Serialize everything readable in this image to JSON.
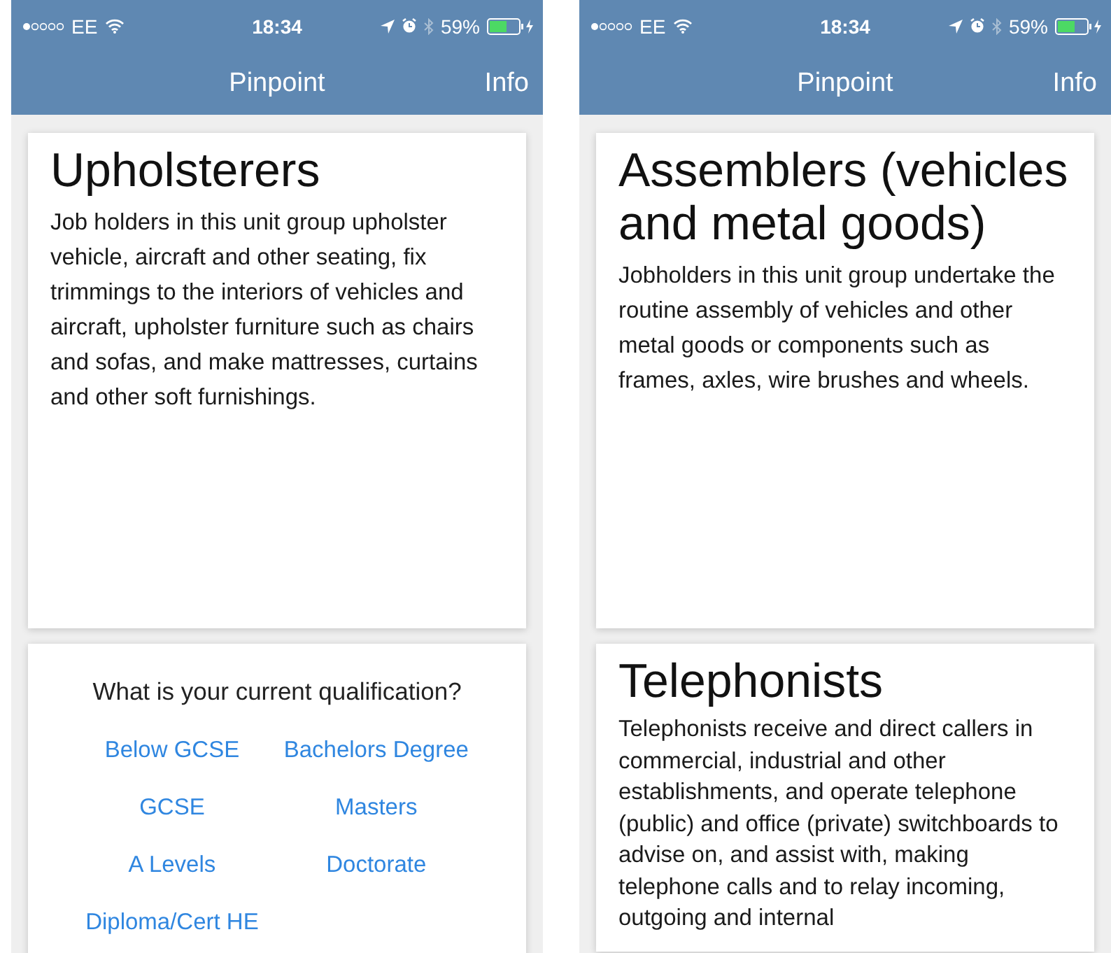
{
  "phones": [
    {
      "status_bar": {
        "carrier": "EE",
        "time": "18:34",
        "battery": "59%"
      },
      "nav": {
        "title": "Pinpoint",
        "action": "Info"
      },
      "cards": [
        {
          "kind": "description",
          "title": "Upholsterers",
          "body": "Job holders in this unit group upholster vehicle, aircraft and other seating, fix trimmings to the interiors of vehicles and aircraft, upholster furniture such as chairs and sofas, and make mattresses, curtains and other soft furnishings."
        },
        {
          "kind": "question",
          "question": "What is your current qualification?",
          "options": [
            "Below GCSE",
            "Bachelors Degree",
            "GCSE",
            "Masters",
            "A Levels",
            "Doctorate",
            "Diploma/Cert HE"
          ]
        }
      ]
    },
    {
      "status_bar": {
        "carrier": "EE",
        "time": "18:34",
        "battery": "59%"
      },
      "nav": {
        "title": "Pinpoint",
        "action": "Info"
      },
      "cards": [
        {
          "kind": "description",
          "title": "Assemblers (vehicles and metal goods)",
          "body": "Jobholders in this unit group undertake the routine assembly of vehicles and other metal goods or components such as frames, axles, wire brushes and wheels."
        },
        {
          "kind": "description",
          "title": "Telephonists",
          "body": "Telephonists receive and direct callers in commercial, industrial and other establishments, and operate telephone (public) and office (private) switchboards to advise on, and assist with, making telephone calls and to relay incoming, outgoing and internal"
        }
      ]
    }
  ]
}
